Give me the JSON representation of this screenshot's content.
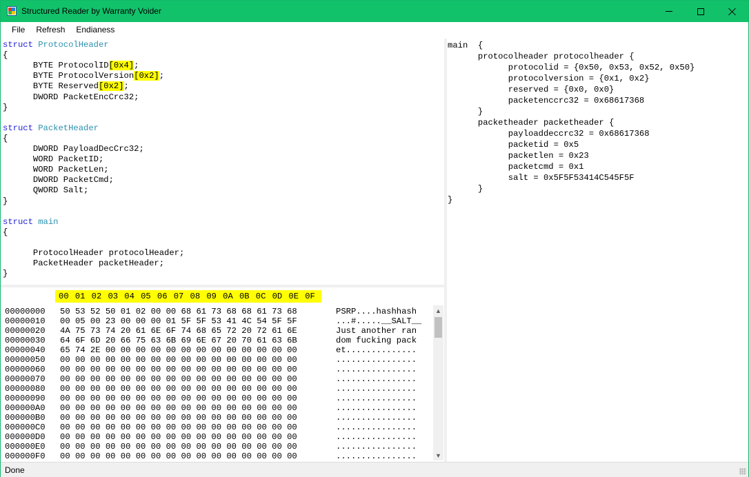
{
  "window": {
    "title": "Structured Reader by Warranty Voider"
  },
  "menu": [
    "File",
    "Refresh",
    "Endianess"
  ],
  "editor_lines": [
    [
      {
        "t": "struct ",
        "c": "kw"
      },
      {
        "t": "ProtocolHeader",
        "c": "tn"
      }
    ],
    [
      {
        "t": "{"
      }
    ],
    [
      {
        "t": "\tBYTE ProtocolID"
      },
      {
        "t": "[0x4]",
        "c": "hl"
      },
      {
        "t": ";"
      }
    ],
    [
      {
        "t": "\tBYTE ProtocolVersion"
      },
      {
        "t": "[0x2]",
        "c": "hl"
      },
      {
        "t": ";"
      }
    ],
    [
      {
        "t": "\tBYTE Reserved"
      },
      {
        "t": "[0x2]",
        "c": "hl"
      },
      {
        "t": ";"
      }
    ],
    [
      {
        "t": "\tDWORD PacketEncCrc32;"
      }
    ],
    [
      {
        "t": "}"
      }
    ],
    [
      {
        "t": ""
      }
    ],
    [
      {
        "t": "struct ",
        "c": "kw"
      },
      {
        "t": "PacketHeader",
        "c": "tn"
      }
    ],
    [
      {
        "t": "{"
      }
    ],
    [
      {
        "t": "\tDWORD PayloadDecCrc32;"
      }
    ],
    [
      {
        "t": "\tWORD PacketID;"
      }
    ],
    [
      {
        "t": "\tWORD PacketLen;"
      }
    ],
    [
      {
        "t": "\tDWORD PacketCmd;"
      }
    ],
    [
      {
        "t": "\tQWORD Salt;"
      }
    ],
    [
      {
        "t": "}"
      }
    ],
    [
      {
        "t": ""
      }
    ],
    [
      {
        "t": "struct ",
        "c": "kw"
      },
      {
        "t": "main",
        "c": "tn"
      }
    ],
    [
      {
        "t": "{"
      }
    ],
    [
      {
        "t": ""
      }
    ],
    [
      {
        "t": "\tProtocolHeader protocolHeader;"
      }
    ],
    [
      {
        "t": "\tPacketHeader packetHeader;"
      }
    ],
    [
      {
        "t": "}"
      }
    ]
  ],
  "output_lines": [
    "main  {",
    "\tprotocolheader protocolheader {",
    "\t\tprotocolid = {0x50, 0x53, 0x52, 0x50}",
    "\t\tprotocolversion = {0x1, 0x2}",
    "\t\treserved = {0x0, 0x0}",
    "\t\tpacketenccrc32 = 0x68617368",
    "\t}",
    "\tpacketheader packetheader {",
    "\t\tpayloaddeccrc32 = 0x68617368",
    "\t\tpacketid = 0x5",
    "\t\tpacketlen = 0x23",
    "\t\tpacketcmd = 0x1",
    "\t\tsalt = 0x5F5F53414C545F5F",
    "\t}",
    "}"
  ],
  "hex": {
    "columns": [
      "00",
      "01",
      "02",
      "03",
      "04",
      "05",
      "06",
      "07",
      "08",
      "09",
      "0A",
      "0B",
      "0C",
      "0D",
      "0E",
      "0F"
    ],
    "rows": [
      {
        "addr": "00000000",
        "bytes": "50 53 52 50 01 02 00 00 68 61 73 68 68 61 73 68",
        "ascii": "PSRP....hashhash"
      },
      {
        "addr": "00000010",
        "bytes": "00 05 00 23 00 00 00 01 5F 5F 53 41 4C 54 5F 5F",
        "ascii": "...#.....__SALT__"
      },
      {
        "addr": "00000020",
        "bytes": "4A 75 73 74 20 61 6E 6F 74 68 65 72 20 72 61 6E",
        "ascii": "Just another ran"
      },
      {
        "addr": "00000030",
        "bytes": "64 6F 6D 20 66 75 63 6B 69 6E 67 20 70 61 63 6B",
        "ascii": "dom fucking pack"
      },
      {
        "addr": "00000040",
        "bytes": "65 74 2E 00 00 00 00 00 00 00 00 00 00 00 00 00",
        "ascii": "et.............."
      },
      {
        "addr": "00000050",
        "bytes": "00 00 00 00 00 00 00 00 00 00 00 00 00 00 00 00",
        "ascii": "................"
      },
      {
        "addr": "00000060",
        "bytes": "00 00 00 00 00 00 00 00 00 00 00 00 00 00 00 00",
        "ascii": "................"
      },
      {
        "addr": "00000070",
        "bytes": "00 00 00 00 00 00 00 00 00 00 00 00 00 00 00 00",
        "ascii": "................"
      },
      {
        "addr": "00000080",
        "bytes": "00 00 00 00 00 00 00 00 00 00 00 00 00 00 00 00",
        "ascii": "................"
      },
      {
        "addr": "00000090",
        "bytes": "00 00 00 00 00 00 00 00 00 00 00 00 00 00 00 00",
        "ascii": "................"
      },
      {
        "addr": "000000A0",
        "bytes": "00 00 00 00 00 00 00 00 00 00 00 00 00 00 00 00",
        "ascii": "................"
      },
      {
        "addr": "000000B0",
        "bytes": "00 00 00 00 00 00 00 00 00 00 00 00 00 00 00 00",
        "ascii": "................"
      },
      {
        "addr": "000000C0",
        "bytes": "00 00 00 00 00 00 00 00 00 00 00 00 00 00 00 00",
        "ascii": "................"
      },
      {
        "addr": "000000D0",
        "bytes": "00 00 00 00 00 00 00 00 00 00 00 00 00 00 00 00",
        "ascii": "................"
      },
      {
        "addr": "000000E0",
        "bytes": "00 00 00 00 00 00 00 00 00 00 00 00 00 00 00 00",
        "ascii": "................"
      },
      {
        "addr": "000000F0",
        "bytes": "00 00 00 00 00 00 00 00 00 00 00 00 00 00 00 00",
        "ascii": "................"
      }
    ]
  },
  "status": {
    "text": "Done"
  },
  "colors": {
    "titlebar": "#12c26b",
    "highlight": "#ffff00",
    "keyword": "#1d1dd6",
    "typename": "#2b91af"
  }
}
